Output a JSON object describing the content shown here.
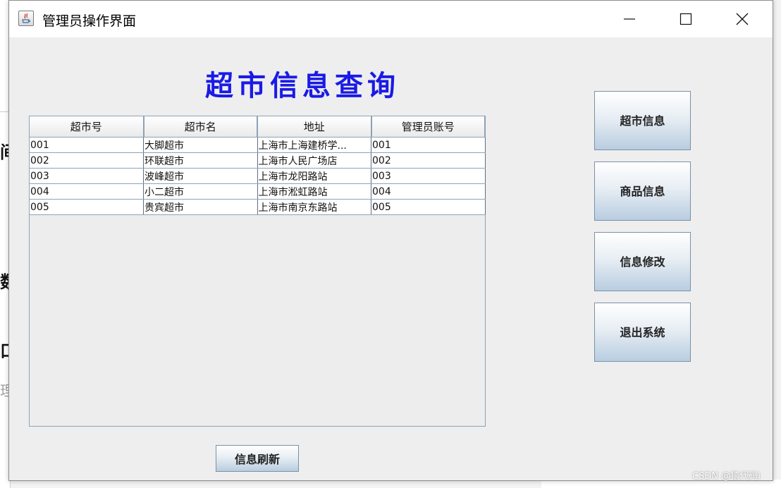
{
  "window": {
    "title": "管理员操作界面"
  },
  "main": {
    "heading": "超市信息查询",
    "table": {
      "columns": [
        "超市号",
        "超市名",
        "地址",
        "管理员账号"
      ],
      "rows": [
        [
          "001",
          "大脚超市",
          "上海市上海建桥学...",
          "001"
        ],
        [
          "002",
          "环联超市",
          "上海市人民广场店",
          "002"
        ],
        [
          "003",
          "波峰超市",
          "上海市龙阳路站",
          "003"
        ],
        [
          "004",
          "小二超市",
          "上海市淞虹路站",
          "004"
        ],
        [
          "005",
          "贵宾超市",
          "上海市南京东路站",
          "005"
        ]
      ]
    },
    "refresh_label": "信息刷新"
  },
  "sidebar": {
    "buttons": [
      {
        "label": "超市信息"
      },
      {
        "label": "商品信息"
      },
      {
        "label": "信息修改"
      },
      {
        "label": "退出系统"
      }
    ]
  },
  "background": {
    "fragments": [
      "间",
      "数",
      "口",
      "理"
    ]
  },
  "watermark": "CSDN @猿代码i",
  "colors": {
    "heading": "#1a1ae6",
    "table_border": "#8da2b8",
    "button_gradient_end": "#b8cde0"
  }
}
